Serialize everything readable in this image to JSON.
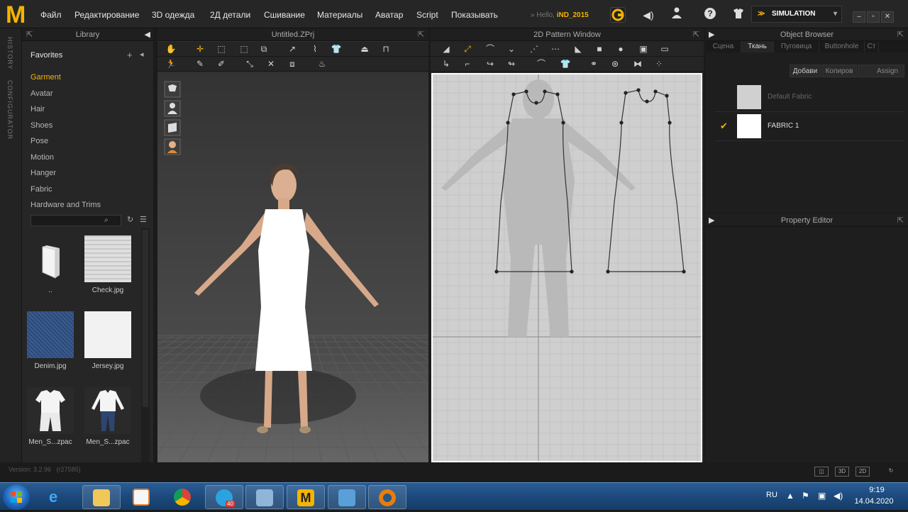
{
  "menu": {
    "logo": "M",
    "items": [
      "Файл",
      "Редактирование",
      "3D одежда",
      "2Д детали",
      "Сшивание",
      "Материалы",
      "Аватар",
      "Script",
      "Показывать"
    ],
    "hello_prefix": "Hello,",
    "username": "iND_2015",
    "simulation_label": "SIMULATION"
  },
  "side_tabs": [
    "HISTORY",
    "CONFIGURATOR"
  ],
  "library": {
    "title": "Library",
    "favorites_label": "Favorites",
    "items": [
      {
        "label": "Garment",
        "active": true
      },
      {
        "label": "Avatar",
        "active": false
      },
      {
        "label": "Hair",
        "active": false
      },
      {
        "label": "Shoes",
        "active": false
      },
      {
        "label": "Pose",
        "active": false
      },
      {
        "label": "Motion",
        "active": false
      },
      {
        "label": "Hanger",
        "active": false
      },
      {
        "label": "Fabric",
        "active": false
      },
      {
        "label": "Hardware and Trims",
        "active": false
      }
    ],
    "thumbnails": [
      "..",
      "Check.jpg",
      "Denim.jpg",
      "Jersey.jpg",
      "Men_S...zpac",
      "Men_S...zpac"
    ]
  },
  "window3d": {
    "title": "Untitled.ZPrj"
  },
  "window2d": {
    "title": "2D Pattern Window"
  },
  "object_browser": {
    "title": "Object Browser",
    "tabs": [
      {
        "label": "Сцена",
        "active": false
      },
      {
        "label": "Ткань",
        "active": true
      },
      {
        "label": "Пуговица",
        "active": false
      },
      {
        "label": "Buttonhole",
        "active": false
      },
      {
        "label": "Ст",
        "active": false
      }
    ],
    "buttons": [
      "Добави",
      "Копиров",
      "Assign"
    ],
    "fabrics": [
      {
        "name": "Default Fabric",
        "checked": false,
        "swatch": "#d0d0d0",
        "label_color": "#666666"
      },
      {
        "name": "FABRIC 1",
        "checked": true,
        "swatch": "#ffffff",
        "label_color": "#dddddd"
      }
    ]
  },
  "property_editor": {
    "title": "Property Editor"
  },
  "status": {
    "version": "Version: 3.2.96",
    "build": "(r27585)",
    "view_buttons": [
      "3D",
      "2D"
    ]
  },
  "taskbar": {
    "language": "RU",
    "time": "9:19",
    "date": "14.04.2020",
    "telegram_badge": "40"
  }
}
